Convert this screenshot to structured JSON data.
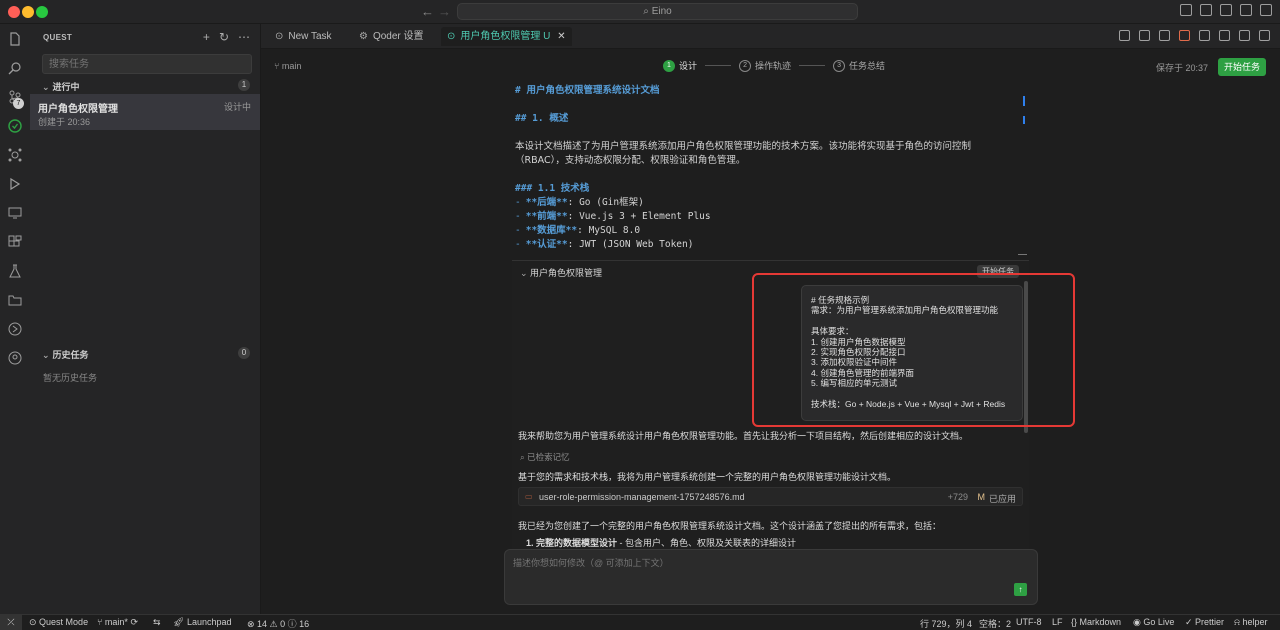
{
  "window": {
    "search_text": "Eino",
    "colors": {
      "close": "#ff5f57",
      "minimize": "#febc2e",
      "zoom": "#28c840",
      "accent_green": "#2ea043",
      "highlight_red": "#e53935"
    }
  },
  "sidebar": {
    "title": "QUEST",
    "search_placeholder": "搜索任务",
    "in_progress": {
      "label": "进行中",
      "count": "1"
    },
    "task": {
      "name": "用户角色权限管理",
      "created": "创建于 20:36",
      "status": "设计中"
    },
    "history": {
      "label": "历史任务",
      "count": "0",
      "empty": "暂无历史任务"
    }
  },
  "tabs": [
    {
      "label": "New Task"
    },
    {
      "label": "Qoder 设置"
    },
    {
      "label": "用户角色权限管理",
      "modified": "U"
    }
  ],
  "header": {
    "branch": "main",
    "steps": [
      {
        "num": "1",
        "label": "设计"
      },
      {
        "num": "2",
        "label": "操作轨迹"
      },
      {
        "num": "3",
        "label": "任务总结"
      }
    ],
    "saved": "保存于 20:37",
    "start_button": "开始任务"
  },
  "doc": {
    "h1": "# 用户角色权限管理系统设计文档",
    "h2": "## 1. 概述",
    "para1": "本设计文档描述了为用户管理系统添加用户角色权限管理功能的技术方案。该功能将实现基于角色的访问控制",
    "para2": "（RBAC），支持动态权限分配、权限验证和角色管理。",
    "h3": "### 1.1 技术栈",
    "items": [
      {
        "key": "**后端**",
        "val": ": Go (Gin框架)"
      },
      {
        "key": "**前端**",
        "val": ": Vue.js 3 + Element Plus"
      },
      {
        "key": "**数据库**",
        "val": ": MySQL 8.0"
      },
      {
        "key": "**认证**",
        "val": ": JWT (JSON Web Token)"
      }
    ]
  },
  "chat": {
    "title": "用户角色权限管理",
    "start": "开始任务",
    "bubble": [
      "# 任务规格示例",
      "需求：为用户管理系统添加用户角色权限管理功能",
      "",
      "具体要求：",
      "1. 创建用户角色数据模型",
      "2. 实现角色权限分配接口",
      "3. 添加权限验证中间件",
      "4. 创建角色管理的前端界面",
      "5. 编写相应的单元测试",
      "",
      "技术栈：Go + Node.js + Vue + Mysql + Jwt + Redis"
    ],
    "reply1": "我来帮助您为用户管理系统设计用户角色权限管理功能。首先让我分析一下项目结构，然后创建相应的设计文档。",
    "memory": "已检索记忆",
    "reply2": "基于您的需求和技术栈，我将为用户管理系统创建一个完整的用户角色权限管理功能设计文档。",
    "file": {
      "name": "user-role-permission-management-1757248576.md",
      "additions": "+729",
      "flag": "M",
      "status": "已应用"
    },
    "reply3": "我已经为您创建了一个完整的用户角色权限管理系统设计文档。这个设计涵盖了您提出的所有需求，包括：",
    "list_item_bold": "1. 完整的数据模型设计",
    "list_item_rest": " - 包含用户、角色、权限及关联表的详细设计",
    "input_placeholder": "描述你想如何修改（@ 可添加上下文）"
  },
  "status": {
    "mode": "Quest Mode",
    "branch": "main*",
    "launchpad": "Launchpad",
    "problems": "⊗ 14 ⚠ 0 ⓘ 16",
    "cursor": "行 729，列 4",
    "spaces": "空格：2",
    "encoding": "UTF-8",
    "eol": "LF",
    "language": "Markdown",
    "golive": "Go Live",
    "prettier": "Prettier",
    "helper": "helper"
  }
}
